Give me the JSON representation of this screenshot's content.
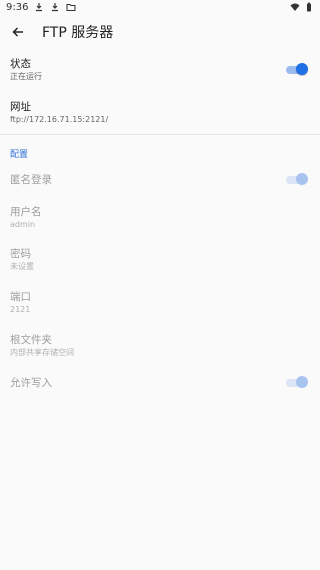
{
  "statusbar": {
    "time": "9:36"
  },
  "header": {
    "title": "FTP 服务器"
  },
  "status": {
    "label": "状态",
    "value": "正在运行",
    "enabled": true
  },
  "address": {
    "label": "网址",
    "value": "ftp://172.16.71.15:2121/"
  },
  "section": {
    "label": "配置"
  },
  "anonymous": {
    "label": "匿名登录",
    "enabled": true
  },
  "username": {
    "label": "用户名",
    "value": "admin"
  },
  "password": {
    "label": "密码",
    "value": "未设置"
  },
  "port": {
    "label": "端口",
    "value": "2121"
  },
  "root": {
    "label": "根文件夹",
    "value": "内部共享存储空间"
  },
  "write": {
    "label": "允许写入",
    "enabled": true
  },
  "colors": {
    "accent": "#1f6fe5",
    "section": "#2f6fd6"
  }
}
